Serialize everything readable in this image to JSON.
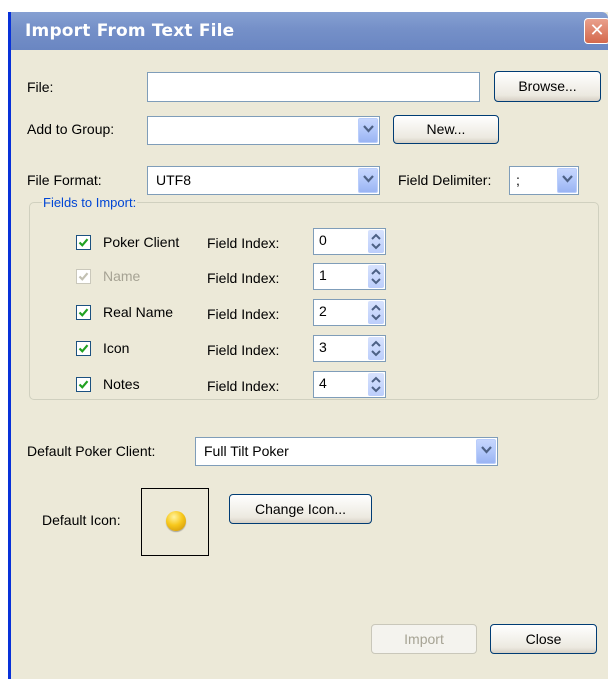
{
  "window": {
    "title": "Import From Text File",
    "close_glyph": "✕"
  },
  "file": {
    "label": "File:",
    "value": "",
    "browse_label": "Browse..."
  },
  "group": {
    "label": "Add to Group:",
    "value": "",
    "new_label": "New..."
  },
  "format": {
    "label": "File Format:",
    "value": "UTF8",
    "delimiter_label": "Field Delimiter:",
    "delimiter_value": ";"
  },
  "fields": {
    "legend": "Fields to Import:",
    "rows": [
      {
        "name": "Poker Client",
        "checked": true,
        "enabled": true,
        "index_label": "Field Index:",
        "index": "0"
      },
      {
        "name": "Name",
        "checked": true,
        "enabled": false,
        "index_label": "Field Index:",
        "index": "1"
      },
      {
        "name": "Real Name",
        "checked": true,
        "enabled": true,
        "index_label": "Field Index:",
        "index": "2"
      },
      {
        "name": "Icon",
        "checked": true,
        "enabled": true,
        "index_label": "Field Index:",
        "index": "3"
      },
      {
        "name": "Notes",
        "checked": true,
        "enabled": true,
        "index_label": "Field Index:",
        "index": "4"
      }
    ]
  },
  "client": {
    "label": "Default Poker Client:",
    "value": "Full Tilt Poker"
  },
  "icon": {
    "label": "Default Icon:",
    "change_label": "Change Icon...",
    "icon_name": "gold-chip-icon"
  },
  "actions": {
    "import_label": "Import",
    "close_label": "Close"
  },
  "colors": {
    "title_bar": "#7590c8",
    "accent_blue": "#0046d5",
    "window_bg": "#ece9d8"
  }
}
